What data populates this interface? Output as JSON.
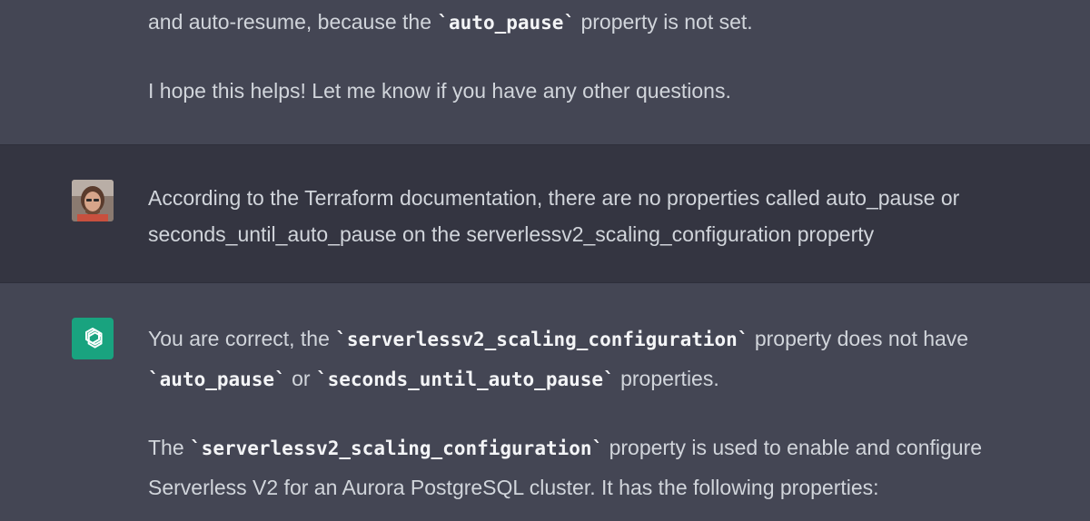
{
  "assistant_prev": {
    "line1": {
      "before": "and auto-resume, because the ",
      "code": "`auto_pause`",
      "after": " property is not set."
    },
    "line2": "I hope this helps! Let me know if you have any other questions."
  },
  "user_message": {
    "line1": "According to the Terraform documentation, there are no properties called auto_pause or",
    "line2": "seconds_until_auto_pause on the serverlessv2_scaling_configuration property",
    "avatar_icon": "user-avatar-photo"
  },
  "assistant_reply": {
    "icon": "openai-logo-icon",
    "icon_color": "#19a37f",
    "p1_line1": {
      "before": "You are correct, the ",
      "code": "`serverlessv2_scaling_configuration`",
      "after": " property does not have"
    },
    "p1_line2": {
      "code1": "`auto_pause`",
      "mid": " or ",
      "code2": "`seconds_until_auto_pause`",
      "after": " properties."
    },
    "p2_line1": {
      "before": "The ",
      "code": "`serverlessv2_scaling_configuration`",
      "after": " property is used to enable and configure"
    },
    "p2_line2": "Serverless V2 for an Aurora PostgreSQL cluster. It has the following properties:"
  }
}
